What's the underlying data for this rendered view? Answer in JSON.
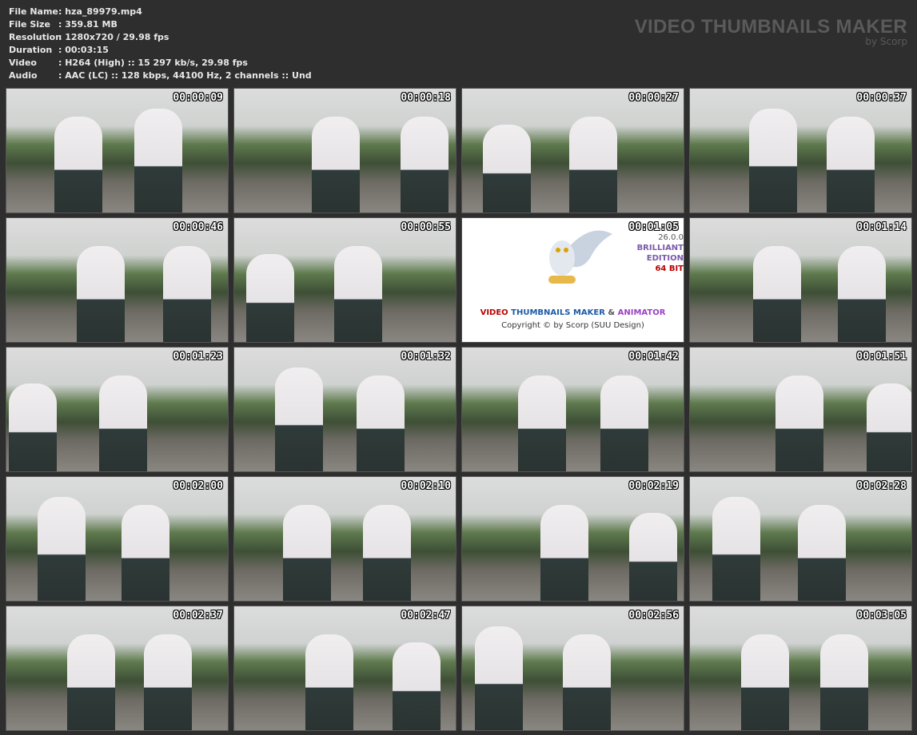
{
  "file_info": [
    {
      "label": "File Name",
      "value": ": hza_89979.mp4"
    },
    {
      "label": "File Size",
      "value": ": 359.81 MB"
    },
    {
      "label": "Resolution",
      "value": ": 1280x720 / 29.98 fps"
    },
    {
      "label": "Duration",
      "value": ": 00:03:15"
    },
    {
      "label": "Video",
      "value": ": H264 (High) :: 15 297 kb/s, 29.98 fps"
    },
    {
      "label": "Audio",
      "value": ": AAC (LC) :: 128 kbps, 44100 Hz, 2 channels :: Und"
    }
  ],
  "brand": {
    "title": "VIDEO THUMBNAILS MAKER",
    "byline": "by Scorp"
  },
  "logo": {
    "word1": "VIDEO",
    "word2": "THUMBNAILS MAKER",
    "word3": "&",
    "word4": "ANIMATOR",
    "copyright": "Copyright © by Scorp (SUU Design)",
    "version": "26.0.0",
    "edition1": "BRILLIANT",
    "edition2": "EDITION",
    "bits": "64 BIT"
  },
  "thumbnails": [
    "00:00:09",
    "00:00:18",
    "00:00:27",
    "00:00:37",
    "00:00:46",
    "00:00:55",
    "00:01:05",
    "00:01:14",
    "00:01:23",
    "00:01:32",
    "00:01:42",
    "00:01:51",
    "00:02:00",
    "00:02:10",
    "00:02:19",
    "00:02:28",
    "00:02:37",
    "00:02:47",
    "00:02:56",
    "00:03:05"
  ],
  "colors": {
    "background": "#2e2e2e",
    "brand": "#5a5a5a"
  }
}
